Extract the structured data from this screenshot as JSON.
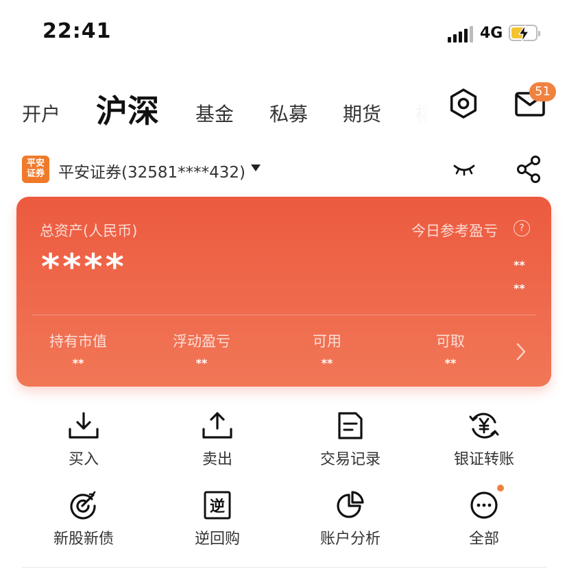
{
  "status_bar": {
    "time": "22:41",
    "network": "4G",
    "battery_charging": true
  },
  "tabs": [
    {
      "label": "开户",
      "active": false
    },
    {
      "label": "沪深",
      "active": true
    },
    {
      "label": "基金",
      "active": false
    },
    {
      "label": "私募",
      "active": false
    },
    {
      "label": "期货",
      "active": false
    },
    {
      "label": "權",
      "active": false
    }
  ],
  "header": {
    "message_badge": "51"
  },
  "account": {
    "logo_text_line1": "平安",
    "logo_text_line2": "证券",
    "name": "平安证券(32581****432)"
  },
  "assets": {
    "total_label": "总资产(人民币)",
    "total_value": "****",
    "today_pnl_label": "今日参考盈亏",
    "help_glyph": "?",
    "today_pnl_value_1": "**",
    "today_pnl_value_2": "**",
    "stats": [
      {
        "label": "持有市值",
        "value": "**"
      },
      {
        "label": "浮动盈亏",
        "value": "**"
      },
      {
        "label": "可用",
        "value": "**"
      },
      {
        "label": "可取",
        "value": "**"
      }
    ]
  },
  "actions": [
    {
      "label": "买入",
      "icon": "download-icon"
    },
    {
      "label": "卖出",
      "icon": "upload-icon"
    },
    {
      "label": "交易记录",
      "icon": "document-icon"
    },
    {
      "label": "银证转账",
      "icon": "yuan-transfer-icon"
    },
    {
      "label": "新股新债",
      "icon": "target-icon"
    },
    {
      "label": "逆回购",
      "icon": "reverse-repo-icon"
    },
    {
      "label": "账户分析",
      "icon": "pie-chart-icon"
    },
    {
      "label": "全部",
      "icon": "more-icon"
    }
  ],
  "colors": {
    "card_start": "#ec5a3f",
    "card_end": "#f17757",
    "accent": "#f0823f"
  }
}
